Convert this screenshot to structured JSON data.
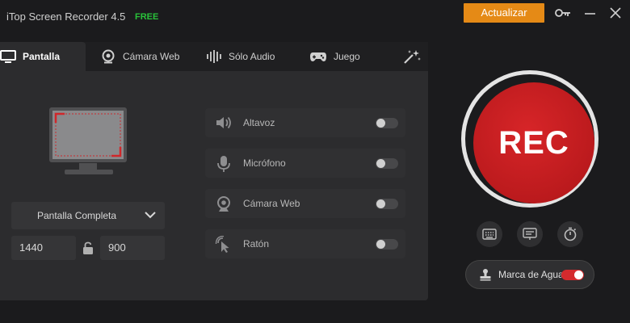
{
  "app": {
    "title": "iTop Screen Recorder 4.5",
    "badge": "FREE",
    "update_label": "Actualizar"
  },
  "tabs": [
    {
      "label": "Pantalla",
      "icon": "monitor-icon",
      "active": true
    },
    {
      "label": "Cámara Web",
      "icon": "webcam-icon",
      "active": false
    },
    {
      "label": "Sólo Audio",
      "icon": "audio-wave-icon",
      "active": false
    },
    {
      "label": "Juego",
      "icon": "gamepad-icon",
      "active": false
    },
    {
      "label": "",
      "icon": "magic-sparkle-icon",
      "active": false
    }
  ],
  "capture": {
    "mode": "Pantalla Completa",
    "width": "1440",
    "height": "900"
  },
  "options": [
    {
      "label": "Altavoz",
      "icon": "speaker-icon",
      "enabled": false
    },
    {
      "label": "Micrófono",
      "icon": "microphone-icon",
      "enabled": false
    },
    {
      "label": "Cámara Web",
      "icon": "webcam-icon",
      "enabled": false
    },
    {
      "label": "Ratón",
      "icon": "mouse-pointer-icon",
      "enabled": false
    }
  ],
  "record": {
    "label": "REC"
  },
  "tools": [
    {
      "icon": "keyboard-icon"
    },
    {
      "icon": "subtitle-icon"
    },
    {
      "icon": "timer-icon"
    }
  ],
  "watermark": {
    "label": "Marca de Agua",
    "enabled": true
  },
  "colors": {
    "accent": "#e58a16",
    "free": "#29c23a",
    "rec": "#c41e21",
    "toggle_on": "#d42a2d"
  }
}
